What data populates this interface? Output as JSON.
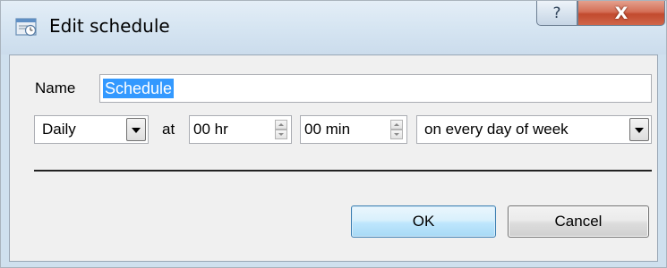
{
  "window": {
    "title": "Edit schedule",
    "icon": "schedule-app-icon",
    "help_glyph": "?",
    "close_glyph": "X"
  },
  "form": {
    "name_label": "Name",
    "name_value": "Schedule",
    "frequency": {
      "selected": "Daily",
      "icon": "chevron-down-icon"
    },
    "at_label": "at",
    "hour_value": "00 hr",
    "minute_value": "00 min",
    "day_selector": {
      "selected": "on every day of week",
      "icon": "chevron-down-icon"
    }
  },
  "buttons": {
    "ok_label": "OK",
    "cancel_label": "Cancel"
  },
  "colors": {
    "selection": "#3399ff",
    "close_button": "#c94f33",
    "ok_button_border": "#3c7fb1"
  }
}
